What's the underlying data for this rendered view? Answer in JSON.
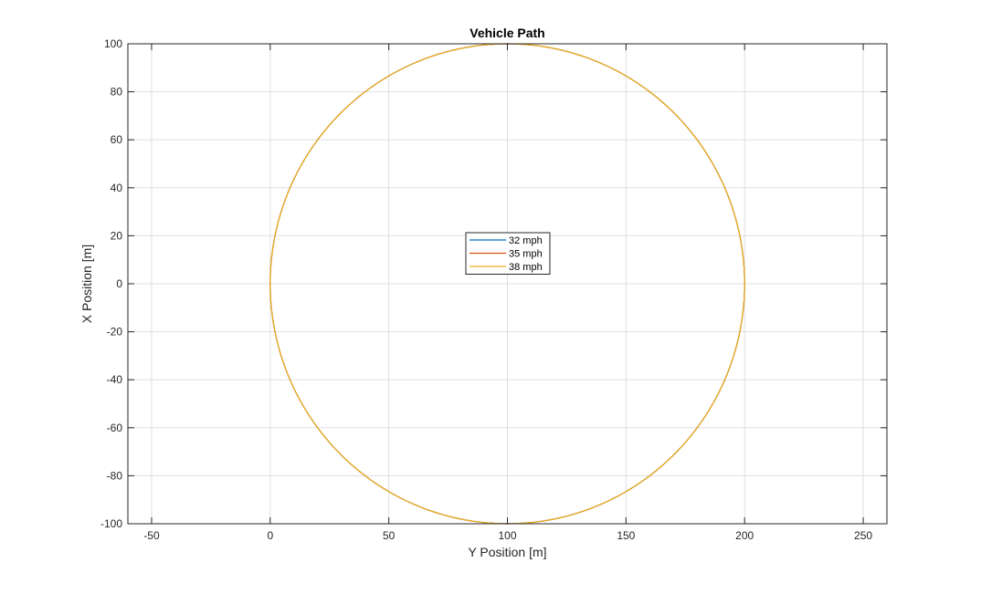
{
  "chart_data": {
    "type": "line",
    "title": "Vehicle Path",
    "xlabel": "Y Position [m]",
    "ylabel": "X Position [m]",
    "xlim": [
      -60,
      260
    ],
    "ylim": [
      -100,
      100
    ],
    "xticks": [
      -50,
      0,
      50,
      100,
      150,
      200,
      250
    ],
    "yticks": [
      -100,
      -80,
      -60,
      -40,
      -20,
      0,
      20,
      40,
      60,
      80,
      100
    ],
    "grid": true,
    "legend_position": "center",
    "path": {
      "shape": "circle",
      "center": [
        100,
        0
      ],
      "radius": 100
    },
    "series": [
      {
        "name": "32 mph",
        "color": "#0072BD"
      },
      {
        "name": "35 mph",
        "color": "#D95319"
      },
      {
        "name": "38 mph",
        "color": "#EDB120"
      }
    ]
  }
}
